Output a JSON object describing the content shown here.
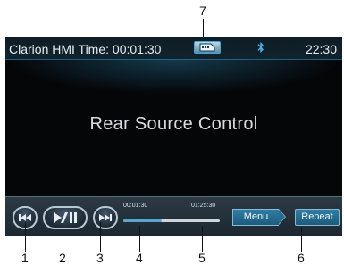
{
  "callouts": [
    "1",
    "2",
    "3",
    "4",
    "5",
    "6",
    "7"
  ],
  "status_bar": {
    "title": "Clarion HMI  Time: 00:01:30",
    "clock": "22:30",
    "icons": [
      "sd-card-icon",
      "bluetooth-icon"
    ]
  },
  "main": {
    "message": "Rear Source Control"
  },
  "playback": {
    "elapsed": "00:01:30",
    "total": "01:25:30",
    "progress_fraction": 0.4,
    "controls": [
      "previous-icon",
      "play-pause-icon",
      "next-icon"
    ]
  },
  "buttons": {
    "menu": "Menu",
    "repeat": "Repeat"
  },
  "colors": {
    "accent": "#2f7ea6",
    "screen_bg": "#050608",
    "bar_bg": "#2c3a45"
  }
}
